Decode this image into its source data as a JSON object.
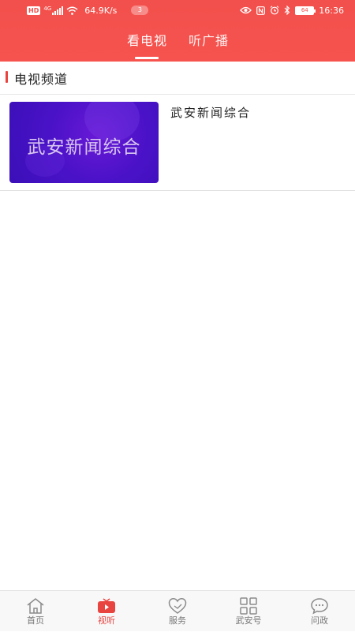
{
  "status_bar": {
    "hd": "HD",
    "network": "4G",
    "speed": "64.9K/s",
    "notification_count": "3",
    "battery": "64",
    "time": "16:36"
  },
  "top_tabs": [
    {
      "label": "看电视",
      "active": true
    },
    {
      "label": "听广播",
      "active": false
    }
  ],
  "section": {
    "title": "电视频道"
  },
  "channels": [
    {
      "thumbnail_text": "武安新闻综合",
      "name": "武安新闻综合"
    }
  ],
  "bottom_nav": [
    {
      "label": "首页",
      "icon": "home-icon",
      "active": false
    },
    {
      "label": "视听",
      "icon": "tv-icon",
      "active": true
    },
    {
      "label": "服务",
      "icon": "heart-icon",
      "active": false
    },
    {
      "label": "武安号",
      "icon": "grid-icon",
      "active": false
    },
    {
      "label": "问政",
      "icon": "chat-bubble-icon",
      "active": false
    }
  ],
  "colors": {
    "header_red": "#f2504c",
    "accent_red": "#e94540",
    "thumbnail_purple": "#4b12c8"
  }
}
